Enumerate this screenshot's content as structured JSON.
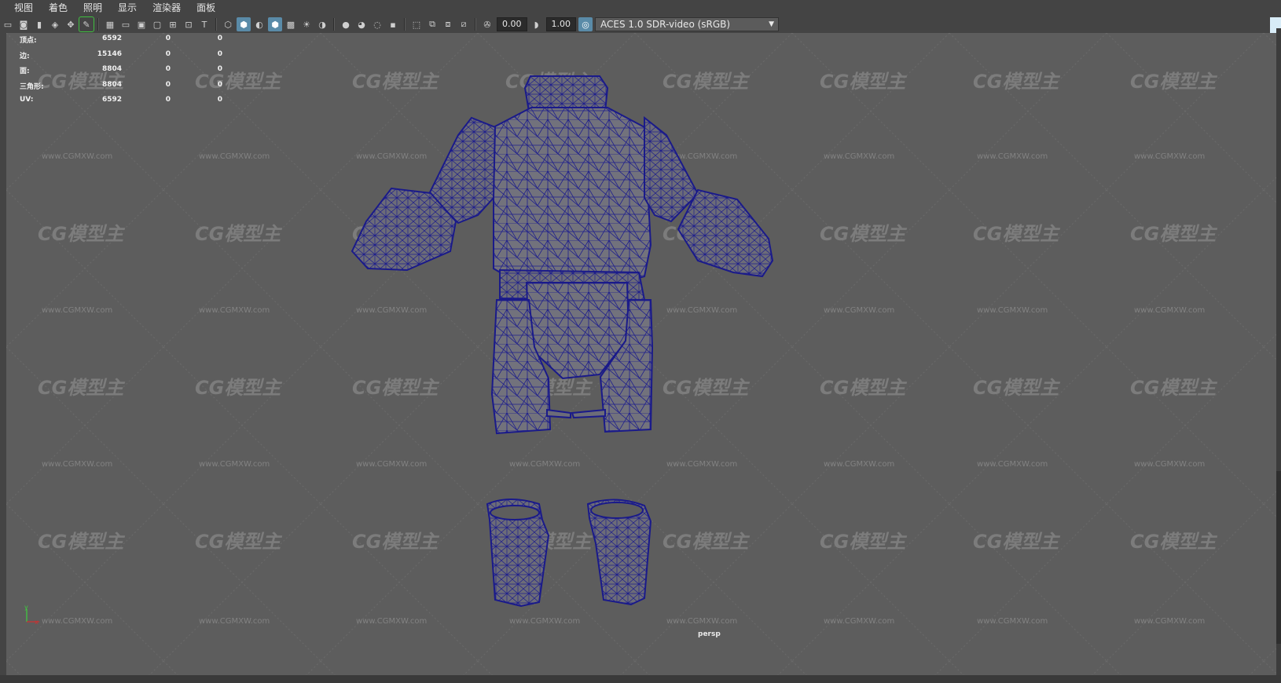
{
  "menu": [
    "视图",
    "着色",
    "照明",
    "显示",
    "渲染器",
    "面板"
  ],
  "toolbar": {
    "exposure": "0.00",
    "gamma": "1.00",
    "color_space": "ACES 1.0 SDR-video (sRGB)"
  },
  "hud": {
    "rows": [
      {
        "label": "顶点:",
        "v1": "6592",
        "v2": "0",
        "v3": "0"
      },
      {
        "label": "边:",
        "v1": "15146",
        "v2": "0",
        "v3": "0"
      },
      {
        "label": "面:",
        "v1": "8804",
        "v2": "0",
        "v3": "0"
      },
      {
        "label": "三角形:",
        "v1": "8804",
        "v2": "0",
        "v3": "0"
      },
      {
        "label": "UV:",
        "v1": "6592",
        "v2": "0",
        "v3": "0"
      }
    ]
  },
  "viewport": {
    "camera": "persp",
    "watermark_logo": "CG模型主",
    "watermark_url": "www.CGMXW.com"
  },
  "colors": {
    "wire": "#1e1e8c",
    "mesh_fill": "#6e6e7a",
    "viewport_bg": "#5d5d5d"
  }
}
